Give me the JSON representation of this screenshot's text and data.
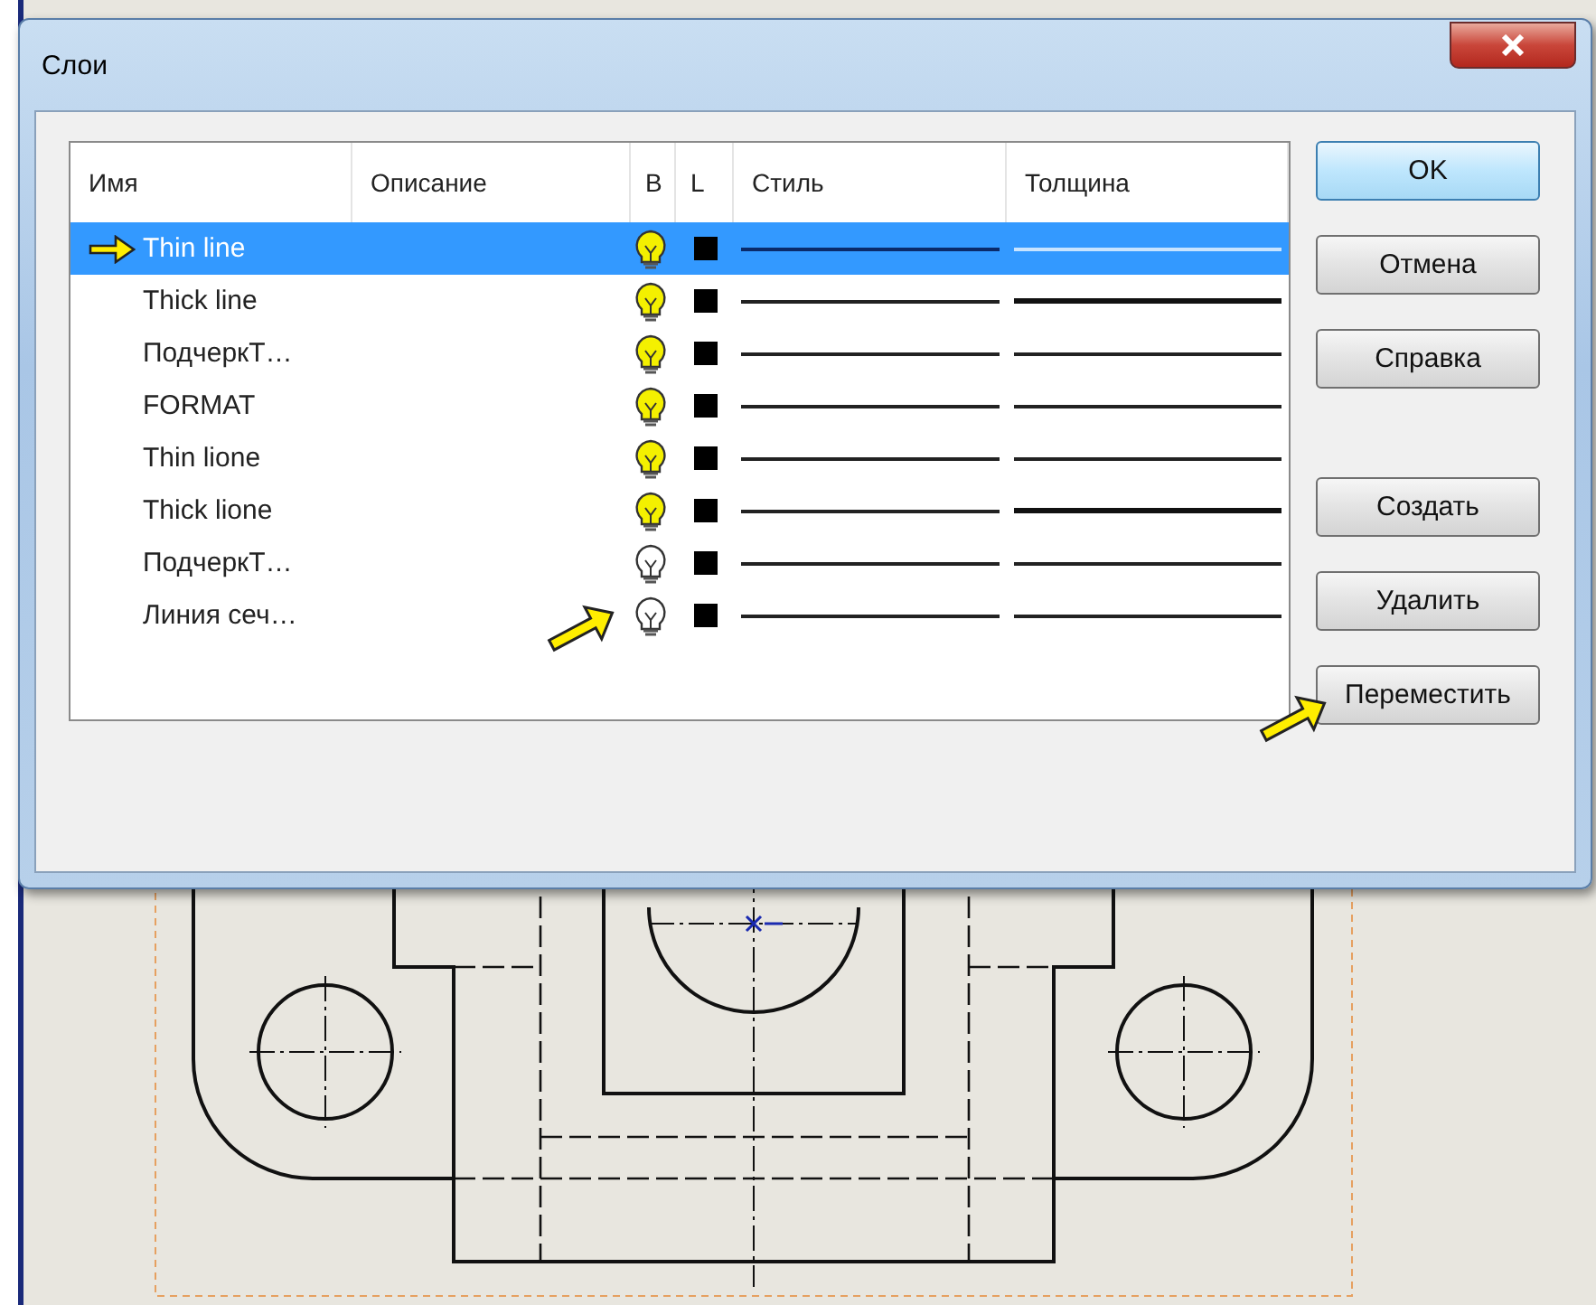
{
  "window": {
    "title": "Слои"
  },
  "table": {
    "columns": [
      "Имя",
      "Описание",
      "B",
      "L",
      "Стиль",
      "Толщина"
    ],
    "rows": [
      {
        "name": "Thin line",
        "selected": true,
        "current": true,
        "visible": true,
        "thick": false
      },
      {
        "name": "Thick line",
        "selected": false,
        "current": false,
        "visible": true,
        "thick": true
      },
      {
        "name": "ПодчеркТ…",
        "selected": false,
        "current": false,
        "visible": true,
        "thick": false
      },
      {
        "name": "FORMAT",
        "selected": false,
        "current": false,
        "visible": true,
        "thick": false
      },
      {
        "name": "Thin lione",
        "selected": false,
        "current": false,
        "visible": true,
        "thick": false
      },
      {
        "name": "Thick lione",
        "selected": false,
        "current": false,
        "visible": true,
        "thick": true
      },
      {
        "name": "ПодчеркТ…",
        "selected": false,
        "current": false,
        "visible": false,
        "thick": false
      },
      {
        "name": "Линия сеч…",
        "selected": false,
        "current": false,
        "visible": false,
        "thick": false
      }
    ]
  },
  "buttons_top": [
    {
      "label": "OK",
      "default": true
    },
    {
      "label": "Отмена",
      "default": false
    },
    {
      "label": "Справка",
      "default": false
    }
  ],
  "buttons_bottom": [
    {
      "label": "Создать",
      "default": false
    },
    {
      "label": "Удалить",
      "default": false
    },
    {
      "label": "Переместить",
      "default": false
    }
  ]
}
